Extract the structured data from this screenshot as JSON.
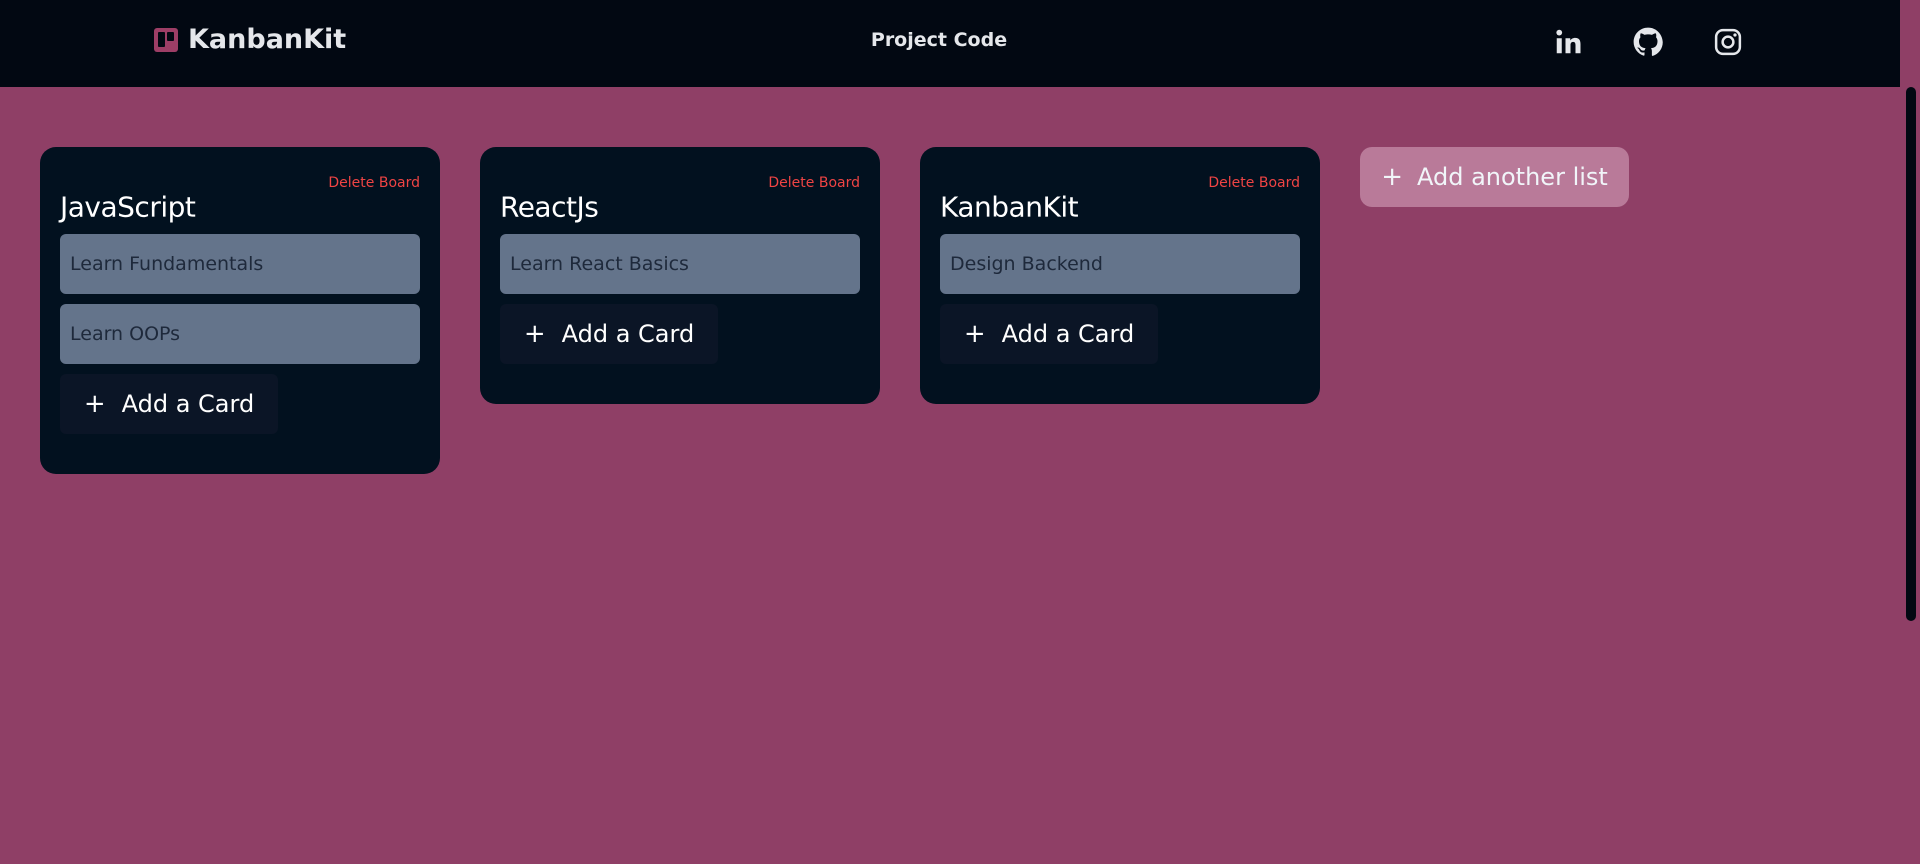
{
  "nav": {
    "brand": "KanbanKit",
    "center_link": "Project Code",
    "social": [
      "linkedin-icon",
      "github-icon",
      "instagram-icon"
    ]
  },
  "colors": {
    "background": "#8f3f66",
    "navbar": "#020812",
    "board": "#02111f",
    "card": "#64748b",
    "delete": "#ef4444",
    "brand_accent": "#9d3e66"
  },
  "boards": [
    {
      "title": "JavaScript",
      "delete_label": "Delete Board",
      "cards": [
        "Learn Fundamentals",
        "Learn OOPs"
      ],
      "add_card_label": "Add a Card"
    },
    {
      "title": "ReactJs",
      "delete_label": "Delete Board",
      "cards": [
        "Learn React Basics"
      ],
      "add_card_label": "Add a Card"
    },
    {
      "title": "KanbanKit",
      "delete_label": "Delete Board",
      "cards": [
        "Design Backend"
      ],
      "add_card_label": "Add a Card"
    }
  ],
  "add_list_label": "Add another list",
  "plus_symbol": "+"
}
